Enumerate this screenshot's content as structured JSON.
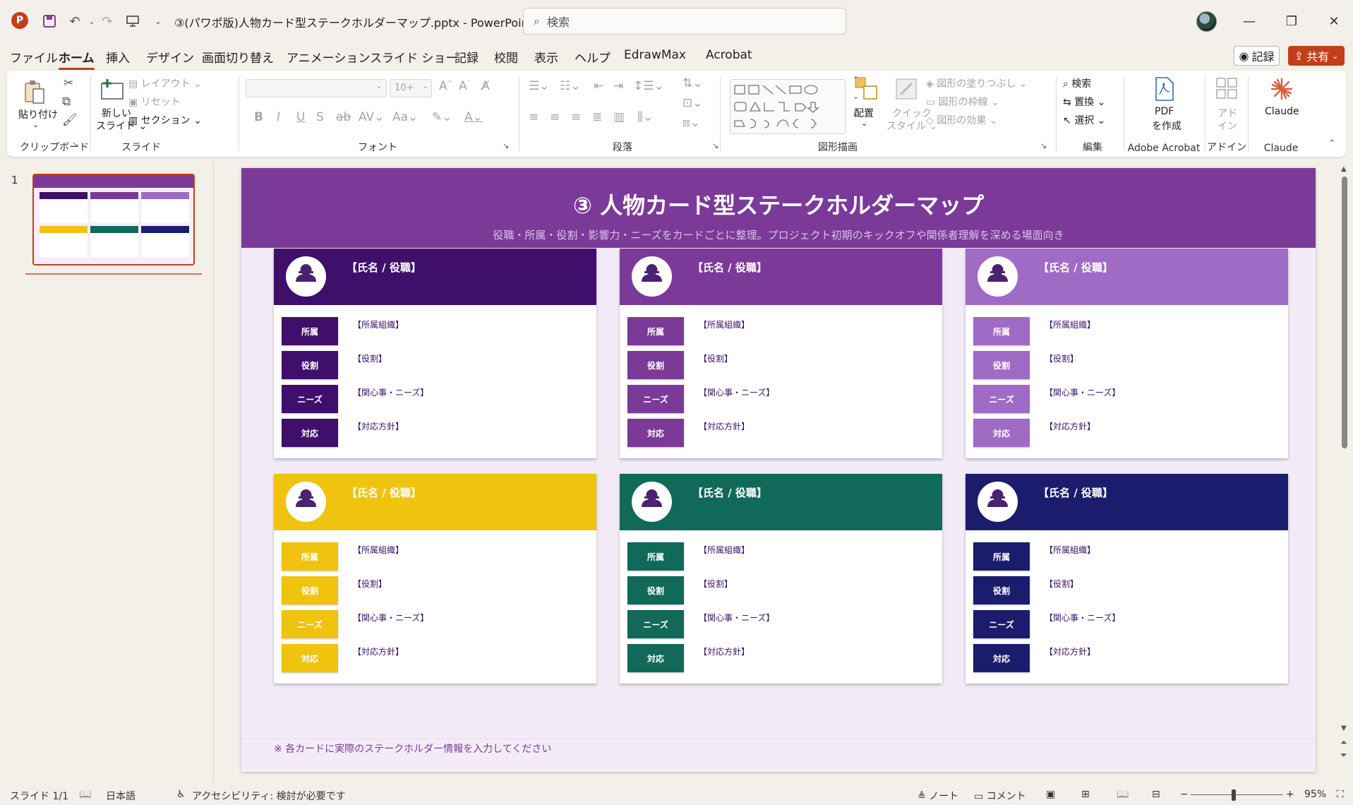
{
  "titlebar": {
    "doc_title": "③(パワポ版)人物カード型ステークホルダーマップ.pptx  -  PowerPoint",
    "search_placeholder": "検索"
  },
  "menu": {
    "tabs": [
      "ファイル",
      "ホーム",
      "挿入",
      "デザイン",
      "画面切り替え",
      "アニメーション",
      "スライド ショー",
      "記録",
      "校閲",
      "表示",
      "ヘルプ",
      "EdrawMax",
      "Acrobat"
    ],
    "active": "ホーム",
    "record_label": "記録",
    "share_label": "共有"
  },
  "ribbon": {
    "clipboard": {
      "paste": "貼り付け",
      "label": "クリップボード"
    },
    "slides": {
      "new_slide_1": "新しい",
      "new_slide_2": "スライド",
      "layout": "レイアウト",
      "reset": "リセット",
      "section": "セクション",
      "label": "スライド"
    },
    "font": {
      "size": "10+",
      "label": "フォント"
    },
    "paragraph": {
      "label": "段落"
    },
    "drawing": {
      "arrange": "配置",
      "quick_style_1": "クイック",
      "quick_style_2": "スタイル",
      "fill": "図形の塗りつぶし",
      "outline": "図形の枠線",
      "effects": "図形の効果",
      "label": "図形描画"
    },
    "editing": {
      "find": "検索",
      "replace": "置換",
      "select": "選択",
      "label": "編集"
    },
    "acrobat": {
      "pdf_1": "PDF",
      "pdf_2": "を作成",
      "label": "Adobe Acrobat"
    },
    "addins": {
      "btn_1": "アド",
      "btn_2": "イン",
      "label": "アドイン"
    },
    "claude": {
      "btn": "Claude",
      "label": "Claude"
    }
  },
  "thumbnail_pane": {
    "slide_number": "1"
  },
  "slide": {
    "title": "③ 人物カード型ステークホルダーマップ",
    "subtitle": "役職・所属・役割・影響力・ニーズをカードごとに整理。プロジェクト初期のキックオフや関係者理解を深める場面向き",
    "note": "※ 各カードに実際のステークホルダー情報を入力してください",
    "row_labels": [
      "所属",
      "役割",
      "ニーズ",
      "対応"
    ],
    "row_values": [
      "【所属組織】",
      "【役割】",
      "【関心事・ニーズ】",
      "【対応方針】"
    ],
    "cards": [
      {
        "name": "【氏名 / 役職】",
        "color": "#3f0f6b"
      },
      {
        "name": "【氏名 / 役職】",
        "color": "#7b3a98"
      },
      {
        "name": "【氏名 / 役職】",
        "color": "#a06bc4"
      },
      {
        "name": "【氏名 / 役職】",
        "color": "#f0c30f"
      },
      {
        "name": "【氏名 / 役職】",
        "color": "#11695a"
      },
      {
        "name": "【氏名 / 役職】",
        "color": "#1c1c6e"
      }
    ]
  },
  "statusbar": {
    "slide_count": "スライド 1/1",
    "language": "日本語",
    "accessibility": "アクセシビリティ: 検討が必要です",
    "notes": "ノート",
    "comments": "コメント",
    "zoom": "95%"
  }
}
